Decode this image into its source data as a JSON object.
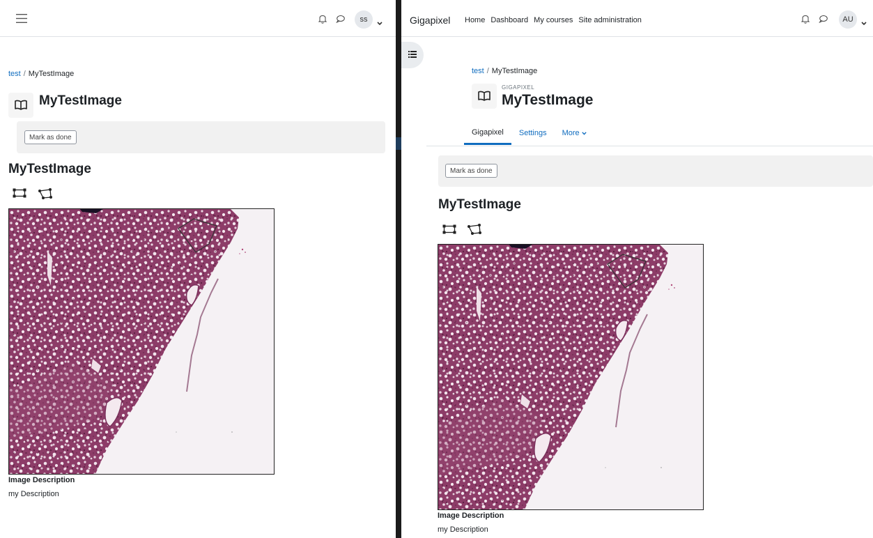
{
  "left": {
    "breadcrumb": {
      "course": "test",
      "current": "MyTestImage"
    },
    "page_title": "MyTestImage",
    "mark_done_label": "Mark as done",
    "section_heading": "MyTestImage",
    "user_initials": "ss",
    "description_label": "Image Description",
    "description_text": "my Description"
  },
  "right": {
    "brand": "Gigapixel",
    "nav": [
      "Home",
      "Dashboard",
      "My courses",
      "Site administration"
    ],
    "breadcrumb": {
      "course": "test",
      "current": "MyTestImage"
    },
    "module_caption": "GIGAPIXEL",
    "page_title": "MyTestImage",
    "tabs": {
      "gigapixel": "Gigapixel",
      "settings": "Settings",
      "more": "More"
    },
    "mark_done_label": "Mark as done",
    "section_heading": "MyTestImage",
    "user_initials": "AU",
    "description_label": "Image Description",
    "description_text": "my Description"
  },
  "colors": {
    "link": "#0f6cbf",
    "tissue": "#8b3a66",
    "background_slide": "#f5f1f4",
    "divider": "#1b1b1b"
  },
  "icons": [
    "hamburger-menu-icon",
    "bell-icon",
    "chat-icon",
    "chevron-down-icon",
    "book-icon",
    "rectangle-tool-icon",
    "polygon-tool-icon",
    "drawer-list-icon"
  ]
}
